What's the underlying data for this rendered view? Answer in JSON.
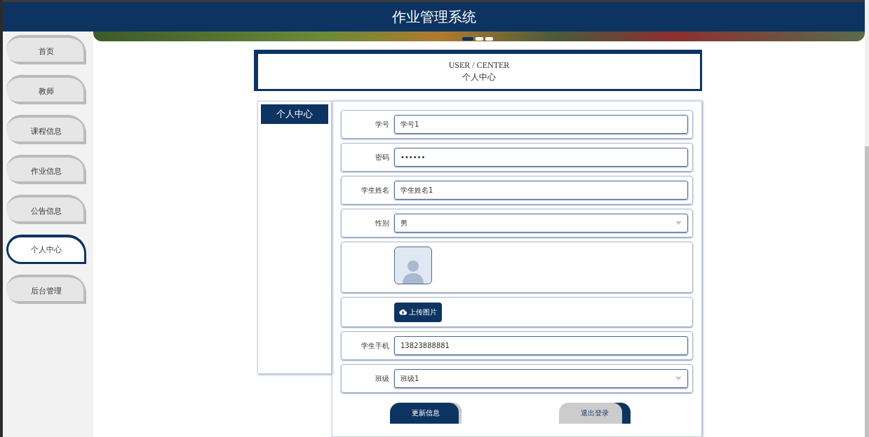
{
  "header": {
    "title": "作业管理系统"
  },
  "sidebar": {
    "items": [
      {
        "label": "首页",
        "selected": false
      },
      {
        "label": "教师",
        "selected": false
      },
      {
        "label": "课程信息",
        "selected": false
      },
      {
        "label": "作业信息",
        "selected": false
      },
      {
        "label": "公告信息",
        "selected": false
      },
      {
        "label": "个人中心",
        "selected": true
      },
      {
        "label": "后台管理",
        "selected": false
      }
    ]
  },
  "banner": {
    "dots": [
      {
        "selected": true
      },
      {
        "selected": false
      },
      {
        "selected": false
      }
    ]
  },
  "page_title": {
    "english": "USER / CENTER",
    "chinese": "个人中心"
  },
  "tabs": [
    {
      "label": "个人中心",
      "selected": true
    }
  ],
  "form": {
    "fields": [
      {
        "kind": "input",
        "label": "学号",
        "value": "学号1"
      },
      {
        "kind": "password",
        "label": "密码",
        "value": "••••••"
      },
      {
        "kind": "input",
        "label": "学生姓名",
        "value": "学生姓名1"
      },
      {
        "kind": "select",
        "label": "性别",
        "value": "男"
      },
      {
        "kind": "image"
      },
      {
        "kind": "upload",
        "button": "上传图片"
      },
      {
        "kind": "input",
        "label": "学生手机",
        "value": "13823888881"
      },
      {
        "kind": "select",
        "label": "班级",
        "value": "班级1"
      }
    ],
    "buttons": [
      {
        "label": "更新信息",
        "kind": "primary"
      },
      {
        "label": "退出登录",
        "kind": "secondary"
      }
    ]
  }
}
